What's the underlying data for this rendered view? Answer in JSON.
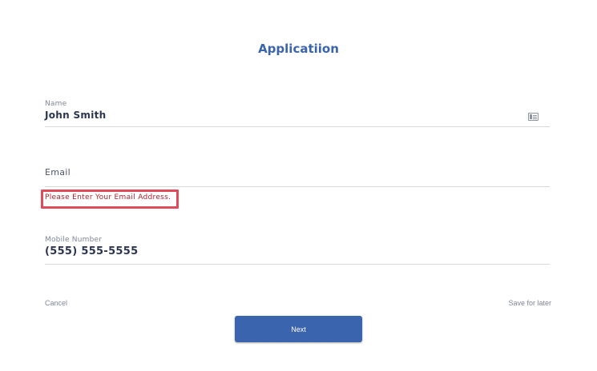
{
  "header": {
    "title": "Applicatiion"
  },
  "form": {
    "name": {
      "label": "Name",
      "value": "John Smith",
      "icon": "id-card-icon"
    },
    "email": {
      "placeholder": "Email",
      "value": "",
      "error": "Please Enter Your Email Address."
    },
    "mobile": {
      "label": "Mobile Number",
      "value": "(555) 555-5555"
    }
  },
  "actions": {
    "cancel_label": "Cancel",
    "save_label": "Save for later",
    "next_label": "Next"
  },
  "colors": {
    "accent": "#3a64ad",
    "error_text": "#b01f2b",
    "error_highlight": "#e04b5a"
  }
}
